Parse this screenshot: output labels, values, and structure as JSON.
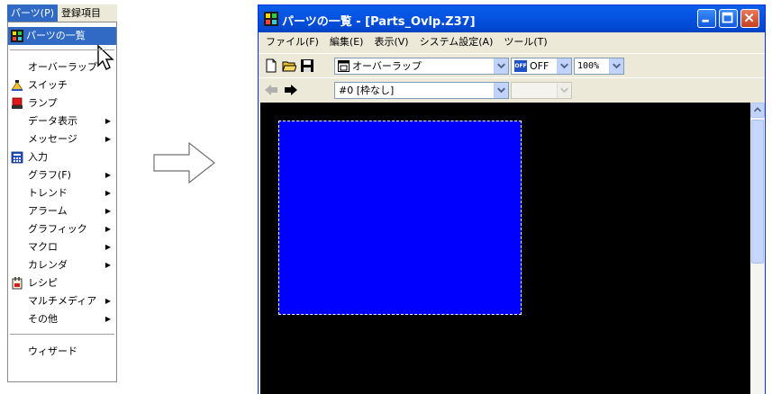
{
  "menu": {
    "bar": [
      "パーツ(P)",
      "登録項目"
    ],
    "items": [
      {
        "label": "パーツの一覧",
        "icon": "parts-list-icon",
        "highlighted": true
      },
      {
        "label": "オーバーラップ"
      },
      {
        "label": "スイッチ",
        "icon": "switch-icon"
      },
      {
        "label": "ランプ",
        "icon": "lamp-icon"
      },
      {
        "label": "データ表示",
        "submenu": true
      },
      {
        "label": "メッセージ",
        "submenu": true
      },
      {
        "label": "入力",
        "icon": "input-icon"
      },
      {
        "label": "グラフ(F)",
        "submenu": true
      },
      {
        "label": "トレンド",
        "submenu": true
      },
      {
        "label": "アラーム",
        "submenu": true
      },
      {
        "label": "グラフィック",
        "submenu": true
      },
      {
        "label": "マクロ",
        "submenu": true
      },
      {
        "label": "カレンダ",
        "submenu": true
      },
      {
        "label": "レシピ",
        "icon": "recipe-icon"
      },
      {
        "label": "マルチメディア",
        "submenu": true
      },
      {
        "label": "その他",
        "submenu": true
      },
      {
        "label": "ウィザード"
      }
    ],
    "submenu_arrow": "▶"
  },
  "window": {
    "title": "パーツの一覧 - [Parts_Ovlp.Z37]",
    "menubar": [
      "ファイル(F)",
      "編集(E)",
      "表示(V)",
      "システム設定(A)",
      "ツール(T)"
    ],
    "toolbar1": {
      "type_combo": "オーバーラップ",
      "state_badge": "OFF",
      "state_combo": "OFF",
      "zoom_combo": "100%"
    },
    "toolbar2": {
      "frame_combo": "#0 [枠なし]",
      "disabled_combo": ""
    },
    "canvas_color": "#000000",
    "part_color": "#0000ff"
  },
  "colors": {
    "menu_highlight": "#316ac5",
    "titlebar": "#0554e3"
  }
}
